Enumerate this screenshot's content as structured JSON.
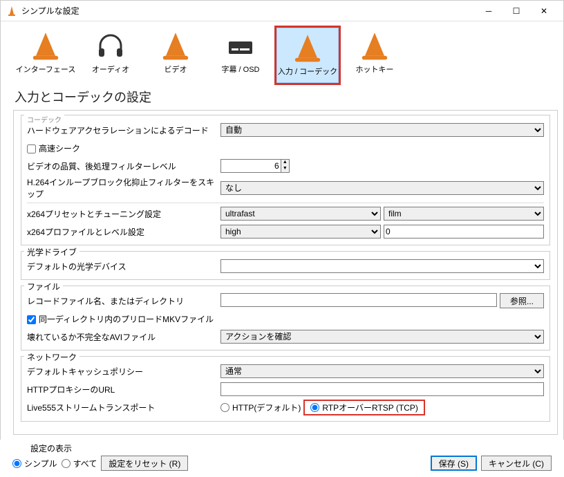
{
  "window": {
    "title": "シンプルな設定"
  },
  "tabs": {
    "interface": "インターフェース",
    "audio": "オーディオ",
    "video": "ビデオ",
    "subtitle": "字幕 / OSD",
    "input_codec": "入力 / コーデック",
    "hotkeys": "ホットキー"
  },
  "heading": "入力とコーデックの設定",
  "codec": {
    "truncated_header": "コーデック",
    "hw_decode_label": "ハードウェアアクセラレーションによるデコード",
    "hw_decode_value": "自動",
    "fastseek_label": "高速シーク",
    "quality_label": "ビデオの品質、後処理フィルターレベル",
    "quality_value": "6",
    "h264_skip_label": "H.264インループブロック化抑止フィルターをスキップ",
    "h264_skip_value": "なし",
    "x264_preset_label": "x264プリセットとチューニング設定",
    "x264_preset_value": "ultrafast",
    "x264_tune_value": "film",
    "x264_profile_label": "x264プロファイルとレベル設定",
    "x264_profile_value": "high",
    "x264_level_value": "0"
  },
  "optical": {
    "legend": "光学ドライブ",
    "default_label": "デフォルトの光学デバイス",
    "default_value": ""
  },
  "file": {
    "legend": "ファイル",
    "record_label": "レコードファイル名、またはディレクトリ",
    "record_value": "",
    "browse": "参照...",
    "preload_label": "同一ディレクトリ内のプリロードMKVファイル",
    "avi_label": "壊れているか不完全なAVIファイル",
    "avi_value": "アクションを確認"
  },
  "network": {
    "legend": "ネットワーク",
    "cache_label": "デフォルトキャッシュポリシー",
    "cache_value": "通常",
    "proxy_label": "HTTPプロキシーのURL",
    "proxy_value": "",
    "live555_label": "Live555ストリームトランスポート",
    "http_radio": "HTTP(デフォルト)",
    "rtsp_radio": "RTPオーバーRTSP (TCP)"
  },
  "bottom": {
    "show_label": "設定の表示",
    "simple": "シンプル",
    "all": "すべて",
    "reset": "設定をリセット (R)",
    "save": "保存 (S)",
    "cancel": "キャンセル (C)"
  }
}
